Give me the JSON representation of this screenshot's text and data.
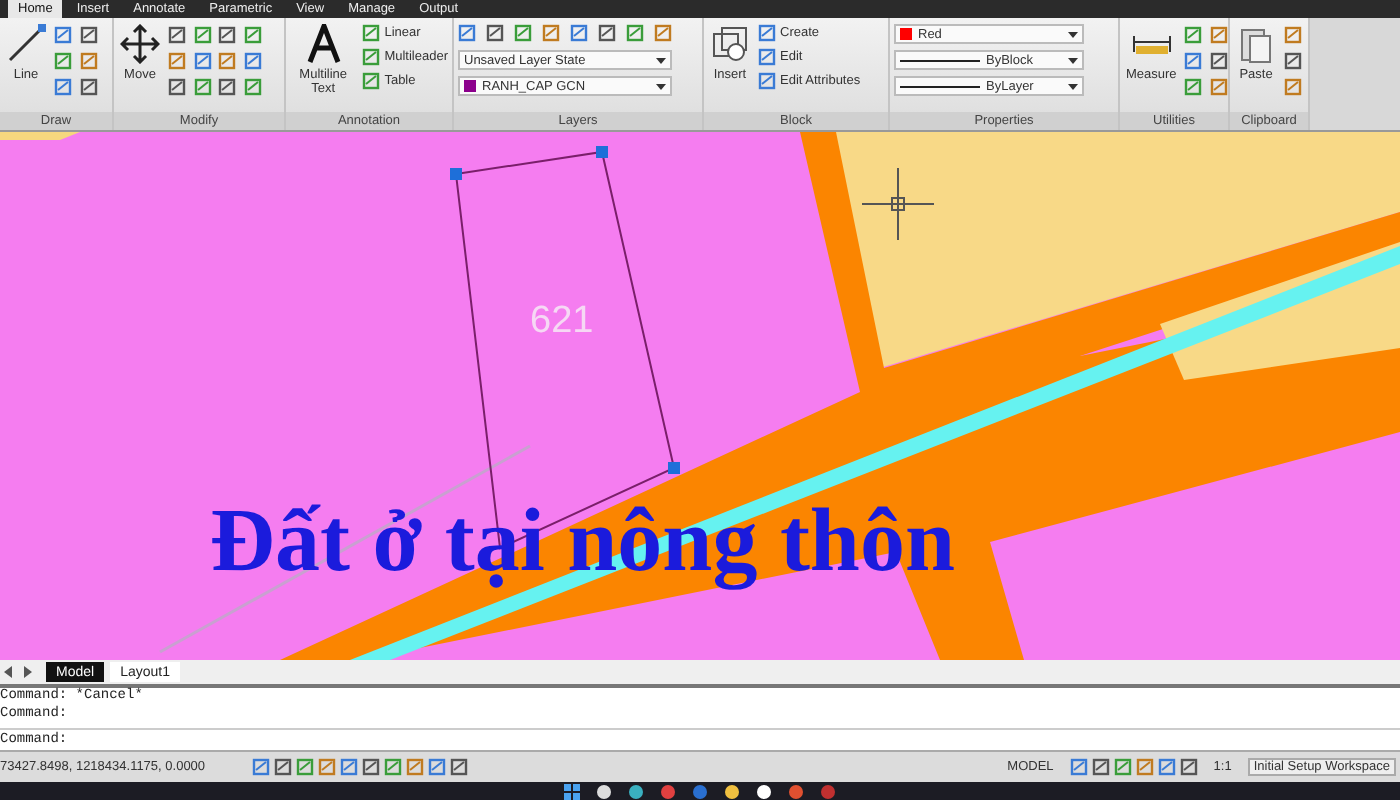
{
  "ribbon_tabs": [
    {
      "label": "Home",
      "selected": true
    },
    {
      "label": "Insert",
      "selected": false
    },
    {
      "label": "Annotate",
      "selected": false
    },
    {
      "label": "Parametric",
      "selected": false
    },
    {
      "label": "View",
      "selected": false
    },
    {
      "label": "Manage",
      "selected": false
    },
    {
      "label": "Output",
      "selected": false
    }
  ],
  "ribbon_panels": [
    {
      "title": "Draw",
      "items": [
        {
          "kind": "large",
          "label": "Line"
        },
        {
          "kind": "icons"
        }
      ]
    },
    {
      "title": "Modify",
      "items": [
        {
          "kind": "large",
          "label": "Move"
        },
        {
          "kind": "icons"
        },
        {
          "kind": "icons"
        }
      ]
    },
    {
      "title": "Annotation",
      "items": [
        {
          "kind": "large",
          "label": "Multiline Text"
        },
        {
          "kind": "stack",
          "items": [
            {
              "kind": "small",
              "label": "Linear"
            },
            {
              "kind": "small",
              "label": "Multileader"
            },
            {
              "kind": "small",
              "label": "Table"
            }
          ]
        }
      ]
    },
    {
      "title": "Layers",
      "items": [
        {
          "kind": "stack",
          "items": [
            {
              "kind": "iconrow"
            },
            {
              "kind": "dropdown",
              "label": "Unsaved Layer State"
            },
            {
              "kind": "dropdown",
              "label": "RANH_CAP GCN",
              "color": "#8b008b"
            }
          ]
        }
      ]
    },
    {
      "title": "Block",
      "items": [
        {
          "kind": "large",
          "label": "Insert"
        },
        {
          "kind": "stack",
          "items": [
            {
              "kind": "small",
              "label": "Create"
            },
            {
              "kind": "small",
              "label": "Edit"
            },
            {
              "kind": "small",
              "label": "Edit Attributes"
            }
          ]
        }
      ]
    },
    {
      "title": "Properties",
      "items": [
        {
          "kind": "stack",
          "items": [
            {
              "kind": "dropdown",
              "label": "Red",
              "color": "#ff0000"
            },
            {
              "kind": "linetype",
              "label": "ByBlock"
            },
            {
              "kind": "linetype",
              "label": "ByLayer"
            }
          ]
        }
      ]
    },
    {
      "title": "Utilities",
      "items": [
        {
          "kind": "large",
          "label": "Measure"
        },
        {
          "kind": "icons"
        }
      ]
    },
    {
      "title": "Clipboard",
      "items": [
        {
          "kind": "large",
          "label": "Paste"
        },
        {
          "kind": "icons"
        }
      ]
    }
  ],
  "drawing": {
    "parcel_label": "621",
    "caption": "Đất ở tại nông thôn"
  },
  "layout_tabs": [
    {
      "label": "Model",
      "selected": true
    },
    {
      "label": "Layout1",
      "selected": false
    }
  ],
  "command_history": [
    "Command: *Cancel*",
    "Command:"
  ],
  "command_prompt": "Command:",
  "status_bar": {
    "coordinates": "73427.8498, 1218434.1175, 0.0000",
    "space": "MODEL",
    "scale": "1:1",
    "workspace": "Initial Setup Workspace"
  }
}
